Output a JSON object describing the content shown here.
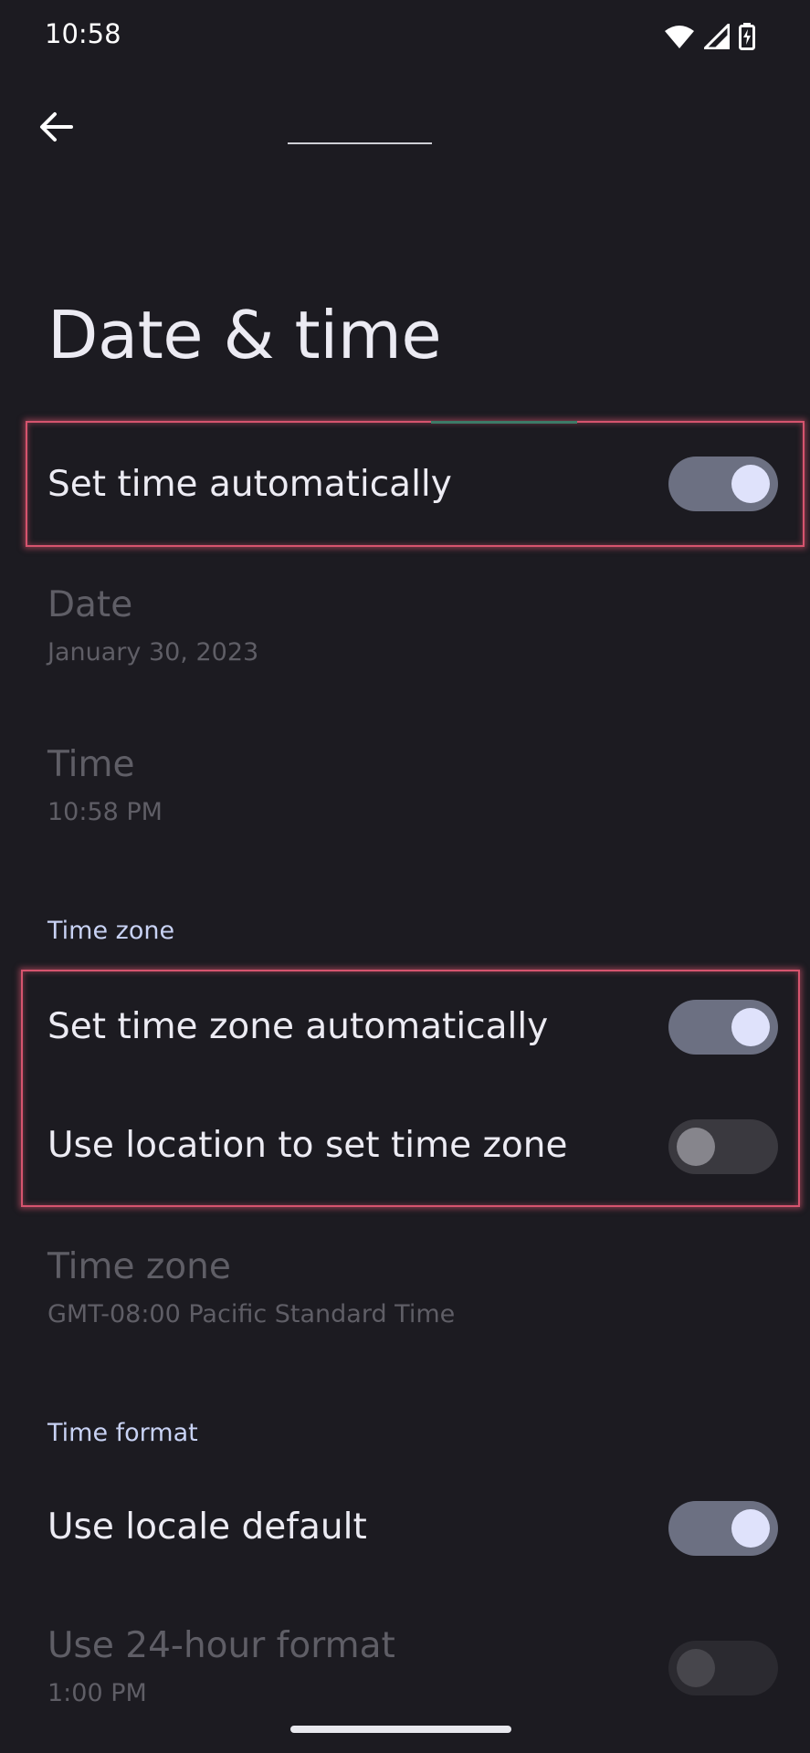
{
  "status_bar": {
    "time": "10:58",
    "icons": [
      "wifi-icon",
      "cellular-signal-icon",
      "battery-charging-icon"
    ]
  },
  "header": {
    "back_icon": "arrow-back-icon"
  },
  "page": {
    "title": "Date & time"
  },
  "settings": {
    "set_time_automatically": {
      "label": "Set time automatically",
      "enabled": true
    },
    "date": {
      "label": "Date",
      "value": "January 30, 2023"
    },
    "time": {
      "label": "Time",
      "value": "10:58 PM"
    },
    "time_zone_section": {
      "header": "Time zone"
    },
    "set_time_zone_automatically": {
      "label": "Set time zone automatically",
      "enabled": true
    },
    "use_location": {
      "label": "Use location to set time zone",
      "enabled": false
    },
    "time_zone": {
      "label": "Time zone",
      "value": "GMT-08:00 Pacific Standard Time"
    },
    "time_format_section": {
      "header": "Time format"
    },
    "use_locale_default": {
      "label": "Use locale default",
      "enabled": true
    },
    "use_24_hour": {
      "label": "Use 24-hour format",
      "value": "1:00 PM",
      "enabled": false
    }
  },
  "colors": {
    "background": "#1c1b21",
    "toggle_on_track": "#6c7082",
    "toggle_on_knob": "#dfe2fb",
    "section_header": "#c8d2f4",
    "highlight": "#d6546e"
  }
}
